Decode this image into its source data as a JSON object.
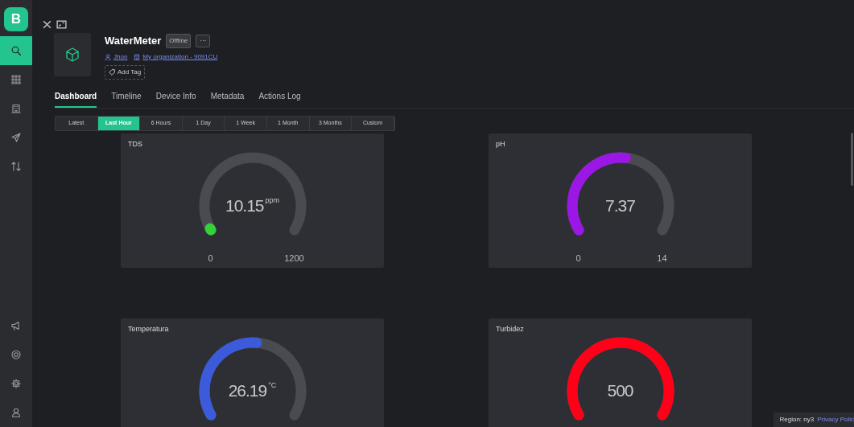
{
  "sidebar": {
    "logo": "B",
    "items": [
      {
        "selected": true
      },
      {
        "selected": false
      },
      {
        "selected": false
      },
      {
        "selected": false
      },
      {
        "selected": false
      }
    ]
  },
  "device": {
    "title": "WaterMeter",
    "status": "Offline",
    "more": "···",
    "owner": "Jhon",
    "organization": "My organization - 9091CU",
    "add_tag": "Add Tag"
  },
  "tabs": [
    {
      "label": "Dashboard",
      "selected": true
    },
    {
      "label": "Timeline",
      "selected": false
    },
    {
      "label": "Device Info",
      "selected": false
    },
    {
      "label": "Metadata",
      "selected": false
    },
    {
      "label": "Actions Log",
      "selected": false
    }
  ],
  "time_ranges": [
    {
      "label": "Latest",
      "selected": false
    },
    {
      "label": "Last Hour",
      "selected": true
    },
    {
      "label": "6 Hours",
      "selected": false
    },
    {
      "label": "1 Day",
      "selected": false
    },
    {
      "label": "1 Week",
      "selected": false
    },
    {
      "label": "1 Month",
      "selected": false
    },
    {
      "label": "3 Months",
      "selected": false
    },
    {
      "label": "Custom",
      "selected": false
    }
  ],
  "widgets": [
    {
      "title": "TDS",
      "value": "10.15",
      "unit": "ppm",
      "min": "0",
      "max": "1200"
    },
    {
      "title": "pH",
      "value": "7.37",
      "min": "0",
      "max": "14"
    },
    {
      "title": "Temperatura",
      "value": "26.19",
      "unit": "°C"
    },
    {
      "title": "Turbidez",
      "value": "500"
    }
  ],
  "footer": {
    "region": "Region: ny3",
    "privacy": "Privacy Polic"
  }
}
